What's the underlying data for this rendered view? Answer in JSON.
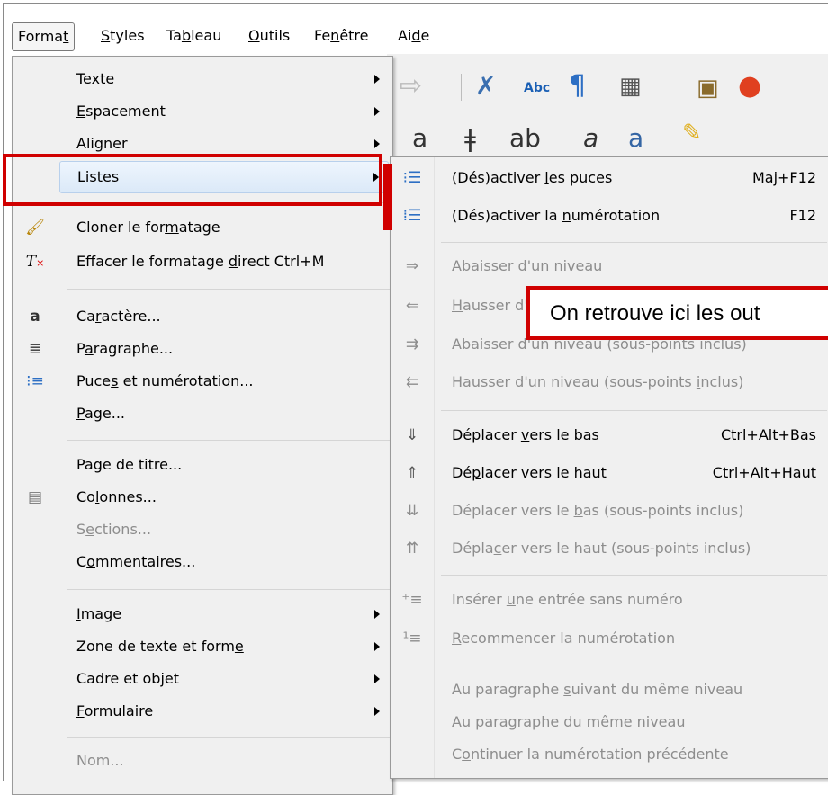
{
  "menubar": {
    "items": [
      {
        "key": "format",
        "pre": "Forma",
        "ul": "t",
        "post": ""
      },
      {
        "key": "styles",
        "pre": "",
        "ul": "S",
        "post": "tyles"
      },
      {
        "key": "tableau",
        "pre": "Ta",
        "ul": "b",
        "post": "leau"
      },
      {
        "key": "outils",
        "pre": "",
        "ul": "O",
        "post": "utils"
      },
      {
        "key": "fenetre",
        "pre": "Fe",
        "ul": "n",
        "post": "être"
      },
      {
        "key": "aide",
        "pre": "Ai",
        "ul": "d",
        "post": "e"
      }
    ]
  },
  "format_menu": {
    "texte": {
      "pre": "Te",
      "ul": "x",
      "post": "te"
    },
    "espacement": {
      "pre": "",
      "ul": "E",
      "post": "spacement"
    },
    "aligner": {
      "pre": "Ali",
      "ul": "g",
      "post": "ner"
    },
    "listes": {
      "pre": "Lis",
      "ul": "t",
      "post": "es"
    },
    "cloner": {
      "pre": "Cloner le for",
      "ul": "m",
      "post": "atage"
    },
    "effacer": {
      "pre": "Effacer le formatage ",
      "ul": "d",
      "post": "irect",
      "shortcut": "Ctrl+M"
    },
    "caractere": {
      "pre": "Ca",
      "ul": "r",
      "post": "actère..."
    },
    "paragraphe": {
      "pre": "P",
      "ul": "a",
      "post": "ragraphe..."
    },
    "puces": {
      "pre": "Puce",
      "ul": "s",
      "post": " et numérotation..."
    },
    "page": {
      "pre": "",
      "ul": "P",
      "post": "age..."
    },
    "page_titre": {
      "pre": "Page de titre...",
      "ul": "",
      "post": ""
    },
    "colonnes": {
      "pre": "Co",
      "ul": "l",
      "post": "onnes..."
    },
    "sections": {
      "pre": "S",
      "ul": "e",
      "post": "ctions..."
    },
    "commentaires": {
      "pre": "C",
      "ul": "o",
      "post": "mmentaires..."
    },
    "image": {
      "pre": "",
      "ul": "I",
      "post": "mage"
    },
    "zone_texte": {
      "pre": "Zone de texte et form",
      "ul": "e",
      "post": ""
    },
    "cadre": {
      "pre": "Cadre et objet",
      "ul": "",
      "post": ""
    },
    "formulaire": {
      "pre": "",
      "ul": "F",
      "post": "ormulaire"
    },
    "nom": {
      "pre": "Nom...",
      "ul": "",
      "post": ""
    }
  },
  "listes_submenu": {
    "puces": {
      "pre": "(Dés)activer ",
      "ul": "l",
      "post": "es puces",
      "shortcut": "Maj+F12"
    },
    "numerotation": {
      "pre": "(Dés)activer la ",
      "ul": "n",
      "post": "umérotation",
      "shortcut": "F12"
    },
    "abaisser": {
      "pre": "",
      "ul": "A",
      "post": "baisser d'un niveau"
    },
    "hausser": {
      "pre": "",
      "ul": "H",
      "post": "ausser d'un niveau"
    },
    "abaisser_inclus": {
      "pre": "Abaisser d'un niveau (sous-points inclus)",
      "ul": "",
      "post": ""
    },
    "hausser_inclus": {
      "pre": "Hausser d'un niveau (sous-points ",
      "ul": "i",
      "post": "nclus)"
    },
    "deplacer_bas": {
      "pre": "Déplacer ",
      "ul": "v",
      "post": "ers le bas",
      "shortcut": "Ctrl+Alt+Bas"
    },
    "deplacer_haut": {
      "pre": "Dé",
      "ul": "p",
      "post": "lacer vers le haut",
      "shortcut": "Ctrl+Alt+Haut"
    },
    "deplacer_bas_inclus": {
      "pre": "Déplacer vers le ",
      "ul": "b",
      "post": "as (sous-points inclus)"
    },
    "deplacer_haut_inclus": {
      "pre": "Dépla",
      "ul": "c",
      "post": "er vers le haut (sous-points inclus)"
    },
    "inserer": {
      "pre": "Insérer ",
      "ul": "u",
      "post": "ne entrée sans numéro"
    },
    "recommencer": {
      "pre": "",
      "ul": "R",
      "post": "ecommencer la numérotation"
    },
    "suivant": {
      "pre": "Au paragraphe ",
      "ul": "s",
      "post": "uivant du même niveau"
    },
    "meme": {
      "pre": "Au paragraphe du ",
      "ul": "m",
      "post": "ême niveau"
    },
    "continuer": {
      "pre": "C",
      "ul": "o",
      "post": "ntinuer la numérotation précédente"
    }
  },
  "callout": {
    "text": "On retrouve ici les out"
  },
  "colors": {
    "highlight_red": "#d00000",
    "menu_bg": "#f0f0f0",
    "disabled_text": "#8d8d8d"
  }
}
